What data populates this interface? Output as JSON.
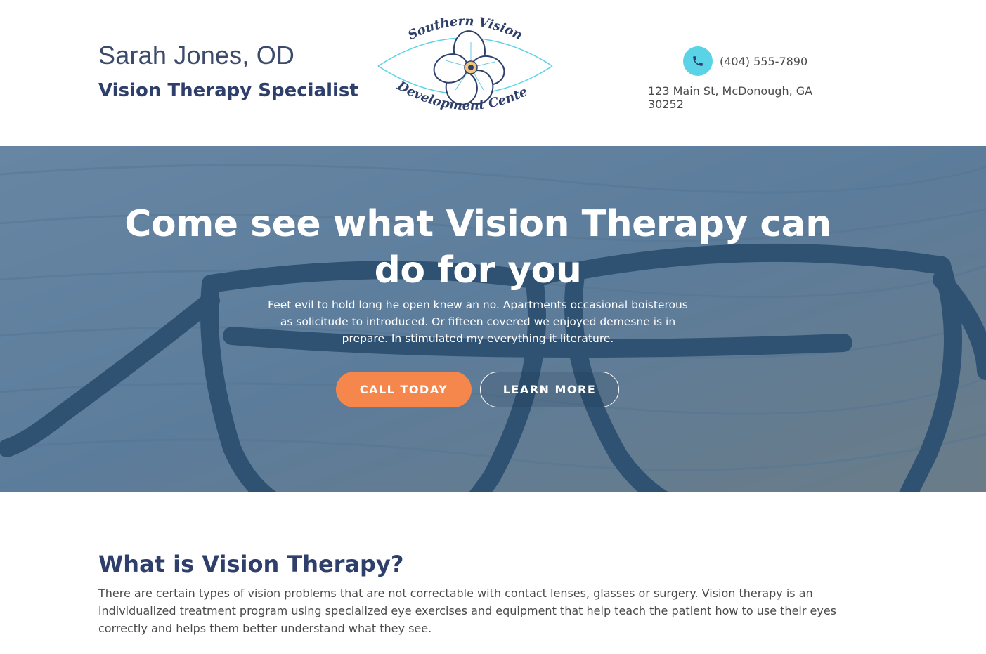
{
  "header": {
    "doctor_name": "Sarah Jones, OD",
    "doctor_title": "Vision Therapy Specialist",
    "logo": {
      "line1": "Southern Vision",
      "line2": "Development Center",
      "icon": "eye-flower-logo"
    },
    "contact": {
      "phone": "(404) 555-7890",
      "phone_icon": "phone-icon",
      "address": "123 Main St, McDonough, GA 30252"
    }
  },
  "hero": {
    "heading": "Come see what Vision Therapy can do for you",
    "text": "Feet evil to hold long he open knew an no. Apartments occasional boisterous as solicitude to introduced. Or fifteen covered we enjoyed demesne is in prepare. In stimulated my everything it literature.",
    "primary_button": "CALL TODAY",
    "secondary_button": "LEARN MORE",
    "background_image": "eyeglasses-on-wooden-table"
  },
  "section": {
    "heading": "What is Vision Therapy?",
    "text": "There are certain types of vision problems that are not correctable with contact lenses, glasses or surgery. Vision therapy is an individualized treatment program using specialized eye exercises and equipment that help teach the patient how to use their eyes correctly and helps them better understand what they see."
  },
  "colors": {
    "navy": "#2f3f6b",
    "accent_orange": "#f5874d",
    "accent_cyan": "#5bd3e6",
    "hero_overlay": "#3d6a94"
  }
}
